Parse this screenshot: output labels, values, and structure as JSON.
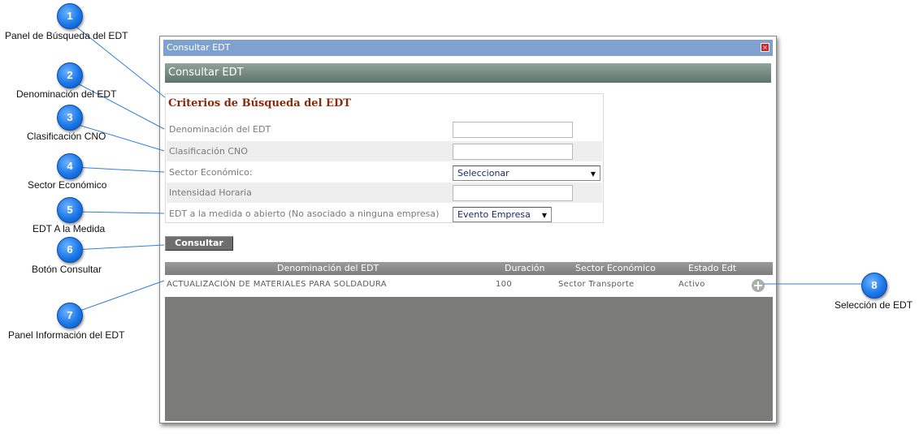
{
  "callouts": [
    {
      "num": "1",
      "label": "Panel de Búsqueda del EDT"
    },
    {
      "num": "2",
      "label": "Denominación del EDT"
    },
    {
      "num": "3",
      "label": "Clasificación CNO"
    },
    {
      "num": "4",
      "label": "Sector Económico"
    },
    {
      "num": "5",
      "label": "EDT A la Medida"
    },
    {
      "num": "6",
      "label": "Botón Consultar"
    },
    {
      "num": "7",
      "label": "Panel Información del EDT"
    },
    {
      "num": "8",
      "label": "Selección de EDT"
    }
  ],
  "dialog": {
    "title": "Consultar EDT",
    "close_label": "×",
    "header": "Consultar EDT"
  },
  "search_panel": {
    "title": "Criterios de Búsqueda del EDT",
    "fields": {
      "denominacion": {
        "label": "Denominación del EDT",
        "value": ""
      },
      "clasificacion": {
        "label": "Clasificación CNO",
        "value": ""
      },
      "sector": {
        "label": "Sector Económico:",
        "selected": "Seleccionar"
      },
      "intensidad": {
        "label": "Intensidad Horaria",
        "value": ""
      },
      "edt_medida": {
        "label": "EDT a la medida o abierto (No asociado a ninguna empresa)",
        "selected": "Evento Empresa"
      }
    }
  },
  "consultar_label": "Consultar",
  "results": {
    "columns": [
      "Denominación del EDT",
      "Duración",
      "Sector Económico",
      "Estado Edt"
    ],
    "rows": [
      {
        "denominacion": "ACTUALIZACIÓN DE MATERIALES PARA SOLDADURA",
        "duracion": "100",
        "sector": "Sector Transporte",
        "estado": "Activo"
      }
    ]
  },
  "colors": {
    "titlebar": "#7fa1cf",
    "header": "#6f8378",
    "panel_title": "#8b2a0a",
    "callout": "#1a78e8",
    "grid_bg": "#7b7b7a"
  }
}
